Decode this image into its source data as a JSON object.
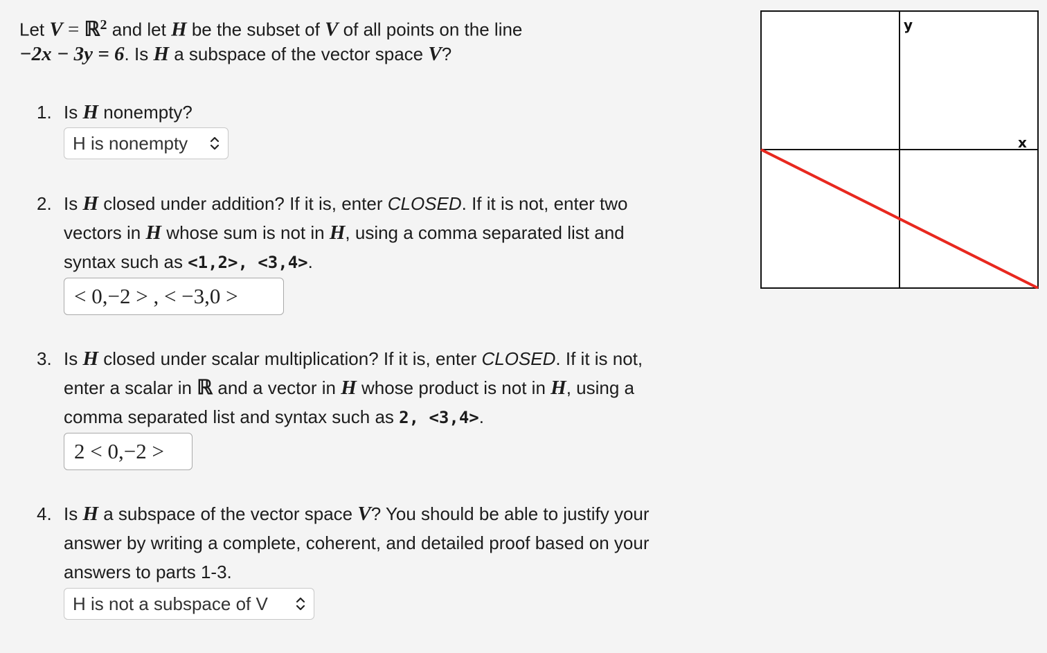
{
  "intro": {
    "line1_pre": "Let ",
    "V": "V",
    "eq": " = ",
    "R": "ℝ",
    "sup2": "2",
    "and_let": " and let ",
    "H": "H",
    "rest1": " be the subset of ",
    "V2": "V",
    "rest2": " of all points on the line",
    "equation": "−2x − 3y = 6",
    "rest3": ". Is ",
    "H2": "H",
    "rest4": " a subspace of the vector space ",
    "V3": "V",
    "q": "?"
  },
  "q1": {
    "num": "1.",
    "pre": "Is ",
    "H": "H",
    "post": " nonempty?",
    "select_value": "H is nonempty"
  },
  "q2": {
    "num": "2.",
    "l1_pre": "Is ",
    "l1_H": "H",
    "l1_mid": " closed under addition? If it is, enter ",
    "l1_closed": "CLOSED",
    "l1_post": ". If it is not, enter two",
    "l2_pre": "vectors in ",
    "l2_H": "H",
    "l2_mid": " whose sum is not in ",
    "l2_H2": "H",
    "l2_post": ", using a comma separated list and",
    "l3_pre": "syntax such as ",
    "l3_code": "<1,2>, <3,4>",
    "l3_post": ".",
    "answer": "< 0,−2 > , < −3,0 >"
  },
  "q3": {
    "num": "3.",
    "l1_pre": "Is ",
    "l1_H": "H",
    "l1_mid": " closed under scalar multiplication? If it is, enter ",
    "l1_closed": "CLOSED",
    "l1_post": ". If it is not,",
    "l2_pre": "enter a scalar in ",
    "l2_R": "ℝ",
    "l2_mid": " and a vector in ",
    "l2_H": "H",
    "l2_mid2": " whose product is not in ",
    "l2_H2": "H",
    "l2_post": ", using a",
    "l3_pre": "comma separated list and syntax such as ",
    "l3_code": "2, <3,4>",
    "l3_post": ".",
    "answer": "2 < 0,−2 >"
  },
  "q4": {
    "num": "4.",
    "l1_pre": "Is ",
    "l1_H": "H",
    "l1_mid": " a subspace of the vector space ",
    "l1_V": "V",
    "l1_post": "? You should be able to justify your",
    "l2": "answer by writing a complete, coherent, and detailed proof based on your",
    "l3": "answers to parts 1-3.",
    "select_value": "H is not a subspace of V"
  },
  "graph": {
    "x_label": "x",
    "y_label": "y",
    "line_color": "#e8281f",
    "axis_color": "#111111"
  },
  "chart_data": {
    "type": "line",
    "x": [
      -3,
      3
    ],
    "y": [
      0,
      -4
    ],
    "xlim": [
      -3,
      3
    ],
    "ylim": [
      -4,
      4
    ],
    "xlabel": "x",
    "ylabel": "y",
    "grid": false
  }
}
